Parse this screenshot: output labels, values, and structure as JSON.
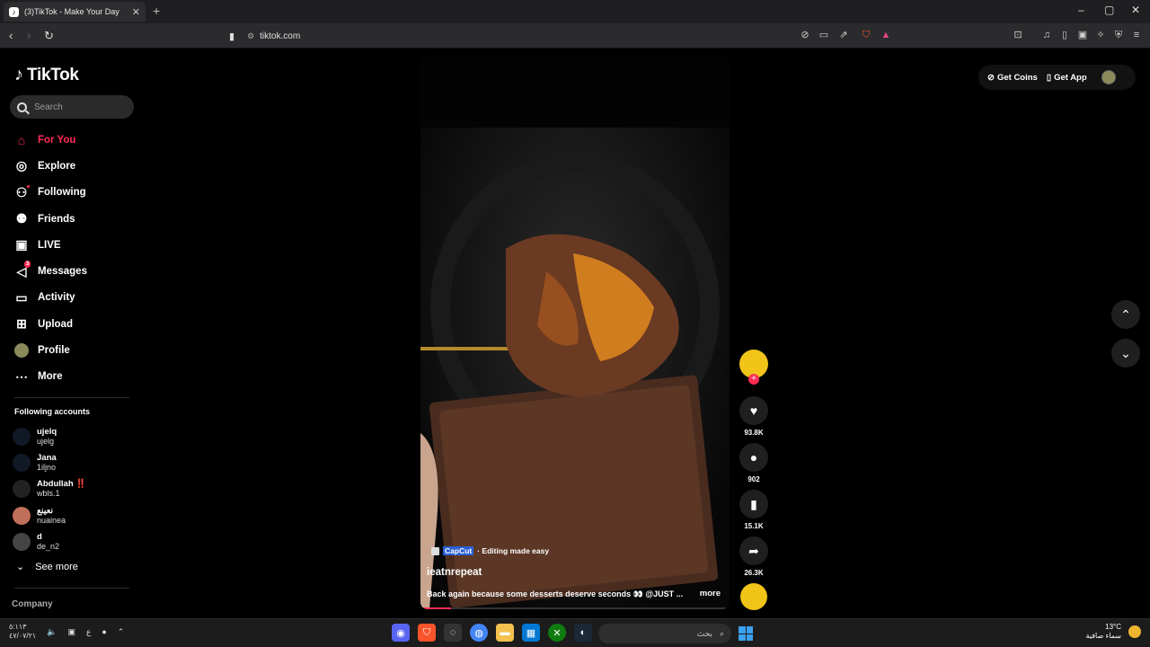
{
  "browser": {
    "tab_title": "(3)TikTok - Make Your Day",
    "url": "tiktok.com"
  },
  "sidebar": {
    "logo": "TikTok",
    "search_placeholder": "Search",
    "nav": [
      {
        "label": "For You",
        "icon": "home-icon",
        "active": true
      },
      {
        "label": "Explore",
        "icon": "compass-icon"
      },
      {
        "label": "Following",
        "icon": "following-icon"
      },
      {
        "label": "Friends",
        "icon": "friends-icon"
      },
      {
        "label": "LIVE",
        "icon": "live-icon"
      },
      {
        "label": "Messages",
        "icon": "messages-icon",
        "badge": "3"
      },
      {
        "label": "Activity",
        "icon": "activity-icon"
      },
      {
        "label": "Upload",
        "icon": "upload-icon"
      },
      {
        "label": "Profile",
        "icon": "profile-avatar"
      },
      {
        "label": "More",
        "icon": "more-icon"
      }
    ],
    "following_title": "Following accounts",
    "accounts": [
      {
        "name": "ujelq",
        "handle": "ujelg"
      },
      {
        "name": "Jana",
        "handle": "1iljno"
      },
      {
        "name": "Abdullah ‼️",
        "handle": "wbls.1"
      },
      {
        "name": "نعينع",
        "handle": "nuainea"
      },
      {
        "name": "d",
        "handle": "de_n2"
      }
    ],
    "see_more": "See more",
    "company": "Company"
  },
  "topbar": {
    "get_coins": "Get Coins",
    "get_app": "Get App"
  },
  "video": {
    "capcut_brand": "CapCut",
    "capcut_text": "· Editing made easy",
    "author": "ieatnrepeat",
    "description": "Back again because some desserts deserve seconds 👀 @JUST ...",
    "more": "more",
    "progress": 0.1
  },
  "actions": {
    "likes": "93.8K",
    "comments": "902",
    "saves": "15.1K",
    "shares": "26.3K"
  },
  "taskbar": {
    "time": "٥:١١٣",
    "date": "٤٧/٠٧/٢١",
    "lang": "ع",
    "search_text": "بحث",
    "temperature": "13°C",
    "weather": "سماء صافية"
  }
}
